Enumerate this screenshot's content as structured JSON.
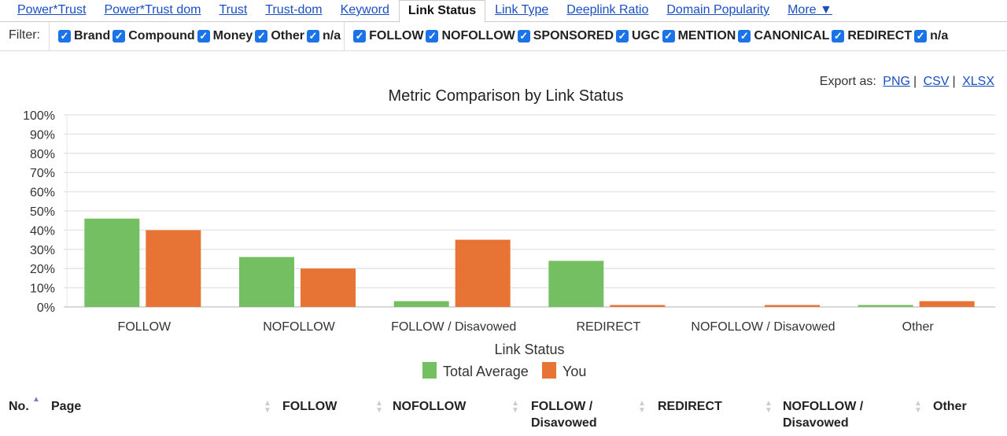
{
  "tabs": [
    "Power*Trust",
    "Power*Trust dom",
    "Trust",
    "Trust-dom",
    "Keyword",
    "Link Status",
    "Link Type",
    "Deeplink Ratio",
    "Domain Popularity",
    "More ▼"
  ],
  "active_tab": "Link Status",
  "filter": {
    "label": "Filter:",
    "group1": [
      "Brand",
      "Compound",
      "Money",
      "Other",
      "n/a"
    ],
    "group2": [
      "FOLLOW",
      "NOFOLLOW",
      "SPONSORED",
      "UGC",
      "MENTION",
      "CANONICAL",
      "REDIRECT",
      "n/a"
    ]
  },
  "export": {
    "label": "Export as:",
    "png": "PNG",
    "csv": "CSV",
    "xlsx": "XLSX"
  },
  "chart_data": {
    "type": "bar",
    "title": "Metric Comparison by Link Status",
    "xlabel": "Link Status",
    "ylabel": "",
    "ylim": [
      0,
      100
    ],
    "yticks": [
      "0%",
      "10%",
      "20%",
      "30%",
      "40%",
      "50%",
      "60%",
      "70%",
      "80%",
      "90%",
      "100%"
    ],
    "categories": [
      "FOLLOW",
      "NOFOLLOW",
      "FOLLOW / Disavowed",
      "REDIRECT",
      "NOFOLLOW / Disavowed",
      "Other"
    ],
    "series": [
      {
        "name": "Total Average",
        "color": "#73bf61",
        "values": [
          46,
          26,
          3,
          24,
          0,
          1
        ]
      },
      {
        "name": "You",
        "color": "#e77435",
        "values": [
          40,
          20,
          35,
          1,
          1,
          3
        ]
      }
    ],
    "grid": true,
    "legend": "bottom"
  },
  "table_headers": [
    "No.",
    "Page",
    "FOLLOW",
    "NOFOLLOW",
    "FOLLOW / Disavowed",
    "REDIRECT",
    "NOFOLLOW / Disavowed",
    "Other"
  ]
}
